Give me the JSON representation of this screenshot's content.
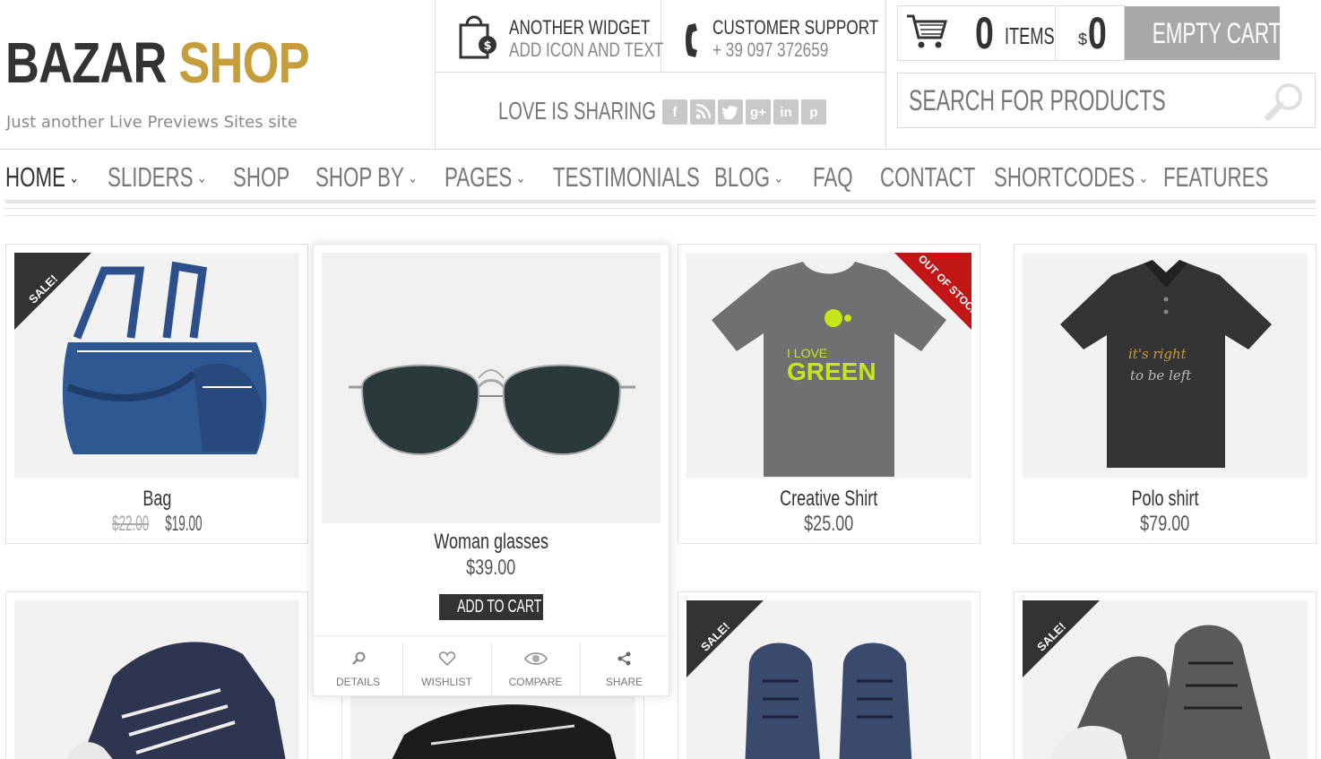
{
  "brand": {
    "name_part1": "BAZAR",
    "name_part2": "SHOP",
    "tagline": "Just another Live Previews Sites site"
  },
  "header": {
    "widget1": {
      "line1": "ANOTHER WIDGET",
      "line2": "ADD ICON AND TEXT"
    },
    "widget2": {
      "line1": "CUSTOMER SUPPORT",
      "line2": "+ 39 097 372659"
    },
    "sharing_label": "LOVE IS SHARING",
    "social": [
      "f",
      "rss",
      "t",
      "g+",
      "in",
      "p"
    ]
  },
  "cart": {
    "count": "0",
    "items_label": "ITEMS",
    "currency": "$",
    "total": "0",
    "empty_label": "EMPTY CART"
  },
  "search": {
    "placeholder": "SEARCH FOR PRODUCTS"
  },
  "nav": {
    "items": [
      {
        "label": "HOME",
        "dropdown": true
      },
      {
        "label": "SLIDERS",
        "dropdown": true
      },
      {
        "label": "SHOP",
        "dropdown": false
      },
      {
        "label": "SHOP BY",
        "dropdown": true
      },
      {
        "label": "PAGES",
        "dropdown": true
      },
      {
        "label": "TESTIMONIALS",
        "dropdown": false
      },
      {
        "label": "BLOG",
        "dropdown": true
      },
      {
        "label": "FAQ",
        "dropdown": false
      },
      {
        "label": "CONTACT",
        "dropdown": false
      },
      {
        "label": "SHORTCODES",
        "dropdown": true
      },
      {
        "label": "FEATURES",
        "dropdown": false
      }
    ],
    "chevron": "⌄"
  },
  "products": [
    {
      "name": "Bag",
      "old_price": "$22.00",
      "price": "$19.00",
      "badge": "SALE!"
    },
    {
      "name": "Woman glasses",
      "price": "$39.00"
    },
    {
      "name": "Creative Shirt",
      "price": "$25.00",
      "badge": "OUT OF STOCK",
      "shirt_text1": "I LOVE",
      "shirt_text2": "GREEN"
    },
    {
      "name": "Polo shirt",
      "price": "$79.00",
      "shirt_text1": "it's right",
      "shirt_text2": "to be left"
    }
  ],
  "row2_badges": [
    "SALE!",
    "SALE!"
  ],
  "hover_actions": {
    "add_to_cart": "ADD TO CART",
    "details": "DETAILS",
    "wishlist": "WISHLIST",
    "compare": "COMPARE",
    "share": "SHARE"
  },
  "colors": {
    "accent": "#c59d3a",
    "sale_badge": "#333333",
    "out_of_stock": "#c01616",
    "button_grey": "#a8a8a8"
  }
}
